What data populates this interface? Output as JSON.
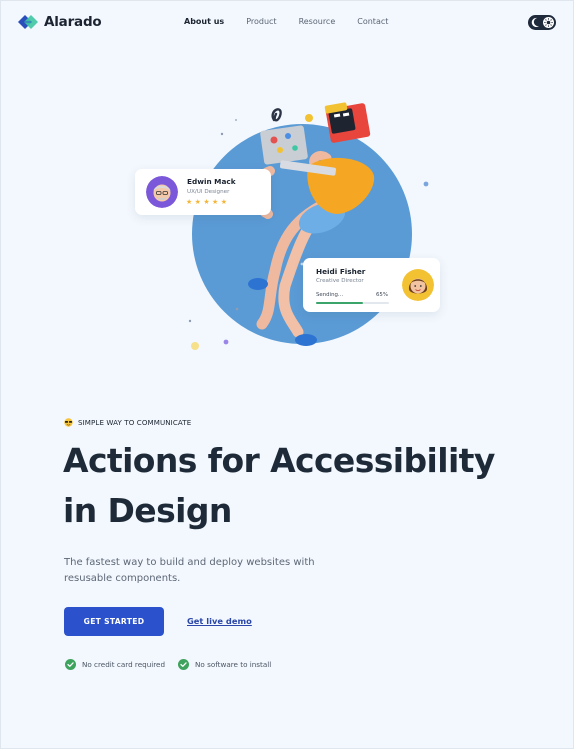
{
  "brand": {
    "name": "Alarado",
    "colors": {
      "mark_dark": "#2a4fbd",
      "mark_light": "#3ec7a3"
    }
  },
  "nav": {
    "links": [
      {
        "label": "About us",
        "active": true
      },
      {
        "label": "Product",
        "active": false
      },
      {
        "label": "Resource",
        "active": false
      },
      {
        "label": "Contact",
        "active": false
      }
    ],
    "theme_toggle": {
      "state": "dark",
      "icons": [
        "moon-icon",
        "sun-icon"
      ]
    }
  },
  "hero_art": {
    "circle_color": "#5b9bd5",
    "profile_cards": [
      {
        "name": "Edwin Mack",
        "role": "UX/UI Designer",
        "rating_stars": 5,
        "avatar": "man-avatar-icon"
      },
      {
        "name": "Heidi Fisher",
        "role": "Creative Director",
        "status_label": "Sending...",
        "progress_text": "65%",
        "progress": 0.65,
        "avatar": "woman-avatar-icon"
      }
    ]
  },
  "hero": {
    "eyebrow_icon": "sunglasses-emoji-icon",
    "eyebrow": "SIMPLE WAY TO COMMUNICATE",
    "headline_line1": "Actions for Accessibility",
    "headline_line2": "in Design",
    "subtext": "The fastest way to build and deploy websites with resusable components.",
    "cta_primary": "GET STARTED",
    "cta_secondary": "Get live demo",
    "checks": [
      "No credit card required",
      "No software to install"
    ],
    "colors": {
      "primary": "#2b52cc",
      "check": "#3ea35c"
    }
  }
}
